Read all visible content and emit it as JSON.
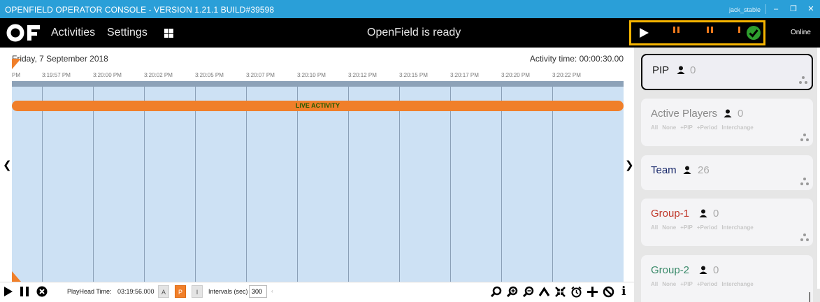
{
  "window": {
    "title": "OPENFIELD OPERATOR CONSOLE - VERSION 1.21.1 BUILD#39598",
    "user": "jack_stable",
    "minimize": "–",
    "restore": "❐",
    "close": "✕"
  },
  "menubar": {
    "logo": "OF",
    "items": [
      "Activities",
      "Settings"
    ],
    "status_message": "OpenField is ready",
    "connection": "Online"
  },
  "timeline": {
    "date": "Friday, 7 September 2018",
    "activity_time": "Activity time: 00:00:30.00",
    "ticks": [
      "PM",
      "3:19:57 PM",
      "3:20:00 PM",
      "3:20:02 PM",
      "3:20:05 PM",
      "3:20:07 PM",
      "3:20:10 PM",
      "3:20:12 PM",
      "3:20:15 PM",
      "3:20:17 PM",
      "3:20:20 PM",
      "3:20:22 PM"
    ],
    "live_label": "LIVE ACTIVITY",
    "nav_left": "❮",
    "nav_right": "❯"
  },
  "transport": {
    "playhead_label": "PlayHead Time:",
    "playhead_time": "03:19:56.000",
    "mode_a": "A",
    "mode_p": "P",
    "mode_i": "I",
    "intervals_label": "Intervals (sec)",
    "intervals_value": "300",
    "tiny_glyph": "‹",
    "info": "i"
  },
  "sidebar": {
    "filters": [
      "All",
      "None",
      "+PIP",
      "+Period",
      "Interchange"
    ],
    "cards": [
      {
        "name": "PIP",
        "count": "0",
        "color": "#222222",
        "selected": true,
        "has_filters": false
      },
      {
        "name": "Active Players",
        "count": "0",
        "color": "#888888",
        "selected": false,
        "has_filters": true
      },
      {
        "name": "Team",
        "count": "26",
        "color": "#1a2a6c",
        "selected": false,
        "has_filters": false
      },
      {
        "name": "Group-1",
        "count": "0",
        "color": "#c0392b",
        "selected": false,
        "has_filters": true
      },
      {
        "name": "Group-2",
        "count": "0",
        "color": "#3a8a6a",
        "selected": false,
        "has_filters": true
      }
    ]
  },
  "colors": {
    "titlebar": "#2a9fd8",
    "accent": "#f07f2a",
    "highlight": "#f5b400",
    "timeline_bg": "#cde1f4"
  }
}
